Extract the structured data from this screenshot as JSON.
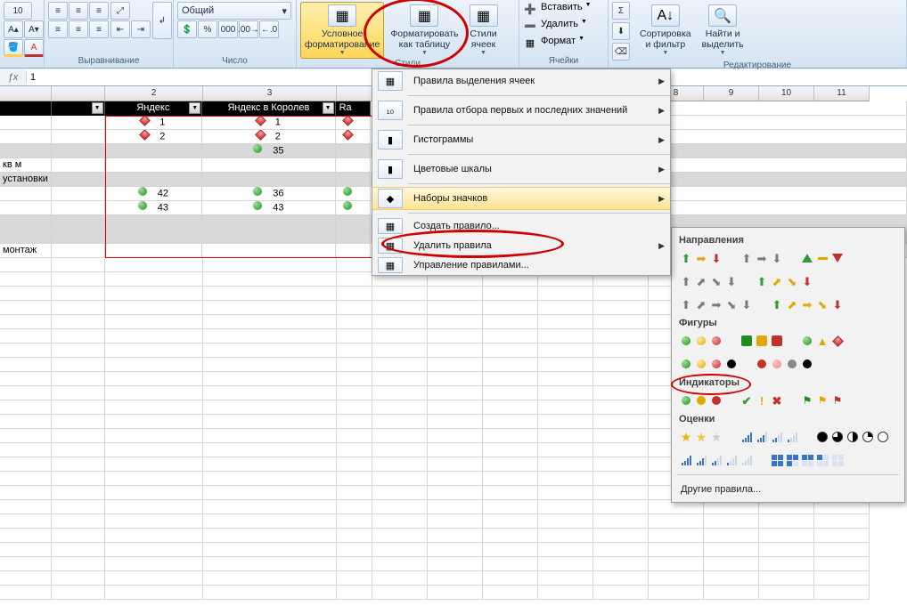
{
  "ribbon": {
    "font": {
      "size": "10"
    },
    "groups": {
      "alignment": "Выравнивание",
      "number": "Число",
      "styles": "Стили",
      "cells": "Ячейки",
      "editing": "Редактирование"
    },
    "number_format": "Общий",
    "cond_format": "Условное\nформатирование",
    "format_as_table": "Форматировать\nкак таблицу",
    "cell_styles": "Стили\nячеек",
    "insert": "Вставить",
    "delete": "Удалить",
    "format": "Формат",
    "sort_filter": "Сортировка\nи фильтр",
    "find_select": "Найти и\nвыделить"
  },
  "formula_bar": {
    "value": "1"
  },
  "sheet": {
    "col_numbers": [
      "2",
      "3",
      "",
      "",
      "",
      "",
      "8",
      "9",
      "10",
      "11"
    ],
    "headers": [
      "Яндекс",
      "Яндекс в Королев",
      "Ra"
    ],
    "rows": [
      {
        "grey": false,
        "label": "",
        "cells": [
          {
            "v": "1",
            "i": "diamond-red"
          },
          {
            "v": "1",
            "i": "diamond-red"
          },
          {
            "v": "",
            "i": "diamond-red"
          }
        ]
      },
      {
        "grey": false,
        "label": "",
        "cells": [
          {
            "v": "2",
            "i": "diamond-red"
          },
          {
            "v": "2",
            "i": "diamond-red"
          },
          {
            "v": "",
            "i": "diamond-red"
          }
        ]
      },
      {
        "grey": true,
        "label": "",
        "cells": [
          {
            "v": "",
            "i": ""
          },
          {
            "v": "35",
            "i": "circle-green"
          },
          {
            "v": "",
            "i": ""
          }
        ]
      },
      {
        "grey": false,
        "label": " кв м",
        "cells": [
          {
            "v": "",
            "i": ""
          },
          {
            "v": "",
            "i": ""
          },
          {
            "v": "",
            "i": ""
          }
        ]
      },
      {
        "grey": true,
        "label": "установки",
        "cells": [
          {
            "v": "",
            "i": ""
          },
          {
            "v": "",
            "i": ""
          },
          {
            "v": "",
            "i": ""
          }
        ]
      },
      {
        "grey": false,
        "label": "",
        "cells": [
          {
            "v": "42",
            "i": "circle-green"
          },
          {
            "v": "36",
            "i": "circle-green"
          },
          {
            "v": "",
            "i": "circle-green"
          }
        ]
      },
      {
        "grey": false,
        "label": "",
        "cells": [
          {
            "v": "43",
            "i": "circle-green"
          },
          {
            "v": "43",
            "i": "circle-green"
          },
          {
            "v": "",
            "i": "circle-green"
          }
        ]
      },
      {
        "grey": true,
        "label": "",
        "cells": [
          {
            "v": "",
            "i": ""
          },
          {
            "v": "",
            "i": ""
          },
          {
            "v": "",
            "i": ""
          }
        ]
      },
      {
        "grey": true,
        "label": "",
        "cells": [
          {
            "v": "",
            "i": ""
          },
          {
            "v": "",
            "i": ""
          },
          {
            "v": "",
            "i": ""
          }
        ]
      },
      {
        "grey": false,
        "label": "монтаж",
        "cells": [
          {
            "v": "",
            "i": ""
          },
          {
            "v": "",
            "i": ""
          },
          {
            "v": "",
            "i": ""
          }
        ]
      }
    ]
  },
  "cf_menu": {
    "highlight": "Правила выделения ячеек",
    "top_bottom": "Правила отбора первых и последних значений",
    "data_bars": "Гистограммы",
    "color_scales": "Цветовые шкалы",
    "icon_sets": "Наборы значков",
    "new_rule": "Создать правило...",
    "clear_rules": "Удалить правила",
    "manage_rules": "Управление правилами..."
  },
  "icon_gallery": {
    "directions": "Направления",
    "shapes": "Фигуры",
    "indicators": "Индикаторы",
    "ratings": "Оценки",
    "more_rules": "Другие правила..."
  }
}
